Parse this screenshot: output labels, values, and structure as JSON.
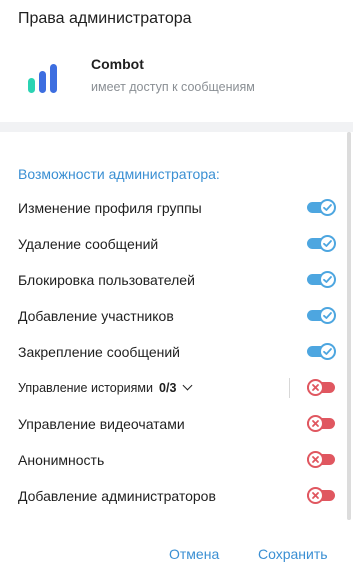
{
  "dialog": {
    "title": "Права администратора"
  },
  "bot": {
    "name": "Combot",
    "subtitle": "имеет доступ к сообщениям"
  },
  "section": {
    "title": "Возможности администратора:"
  },
  "permissions": [
    {
      "label": "Изменение профиля группы",
      "enabled": true
    },
    {
      "label": "Удаление сообщений",
      "enabled": true
    },
    {
      "label": "Блокировка пользователей",
      "enabled": true
    },
    {
      "label": "Добавление участников",
      "enabled": true
    },
    {
      "label": "Закрепление сообщений",
      "enabled": true
    },
    {
      "label": "Управление историями",
      "counter": "0/3",
      "enabled": false
    },
    {
      "label": "Управление видеочатами",
      "enabled": false
    },
    {
      "label": "Анонимность",
      "enabled": false
    },
    {
      "label": "Добавление администраторов",
      "enabled": false
    }
  ],
  "footer": {
    "cancel_label": "Отмена",
    "save_label": "Сохранить"
  },
  "colors": {
    "accent": "#3a8fd3",
    "toggle_on": "#4da6e0",
    "toggle_off": "#e05760"
  }
}
